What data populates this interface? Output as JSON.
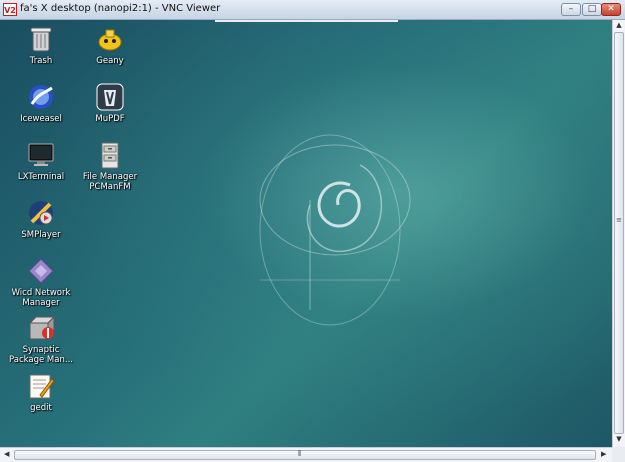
{
  "window": {
    "logo_text": "V2",
    "title": "fa's X desktop (nanopi2:1) - VNC Viewer",
    "min_symbol": "–",
    "max_symbol": "□",
    "close_symbol": "✕"
  },
  "desktop": {
    "icons": [
      {
        "label": "Trash",
        "icon": "trash-icon"
      },
      {
        "label": "Geany",
        "icon": "geany-icon"
      },
      {
        "label": "Iceweasel",
        "icon": "iceweasel-icon"
      },
      {
        "label": "MuPDF",
        "icon": "mupdf-icon"
      },
      {
        "label": "LXTerminal",
        "icon": "terminal-icon"
      },
      {
        "label": "File Manager\nPCManFM",
        "icon": "file-manager-icon"
      },
      {
        "label": "SMPlayer",
        "icon": "smplayer-icon"
      },
      {
        "label": "Wicd Network\nManager",
        "icon": "wicd-icon"
      },
      {
        "label": "Synaptic\nPackage Man...",
        "icon": "synaptic-icon"
      },
      {
        "label": "gedit",
        "icon": "gedit-icon"
      }
    ]
  },
  "colors": {
    "desktop_dark": "#1a4e60",
    "desktop_light": "#2f7f80",
    "close_red": "#c9412c"
  }
}
